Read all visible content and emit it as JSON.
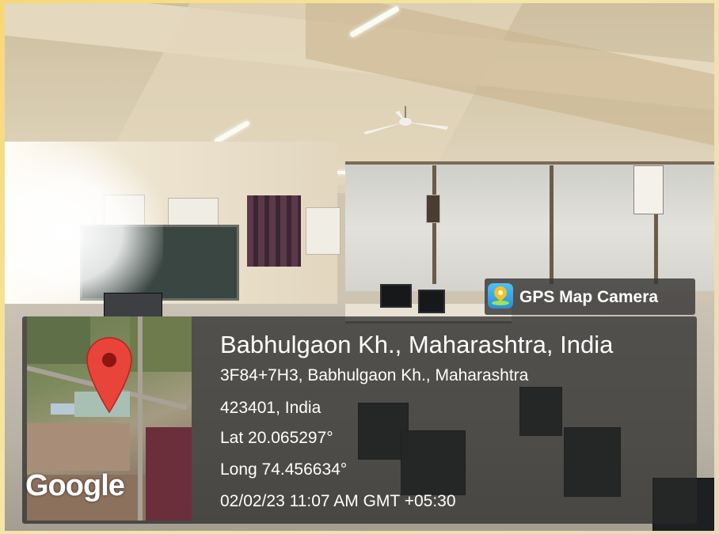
{
  "badge": {
    "app_name": "GPS Map Camera",
    "icon": "gps-map-camera-icon"
  },
  "location": {
    "place": "Babhulgaon Kh., Maharashtra, India",
    "address_line1": "3F84+7H3, Babhulgaon Kh., Maharashtra",
    "address_line2": "423401, India",
    "latitude": "Lat 20.065297°",
    "longitude": "Long 74.456634°",
    "timestamp": "02/02/23 11:07 AM GMT +05:30"
  },
  "map": {
    "provider_logo": "Google",
    "pin_color": "#e8443a"
  },
  "colors": {
    "overlay": "#282828",
    "text": "#ffffff",
    "frame_accent": "#f6d877"
  }
}
